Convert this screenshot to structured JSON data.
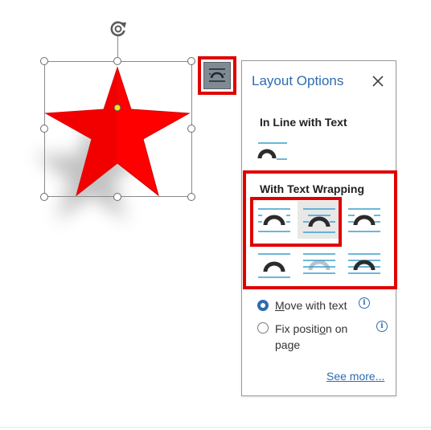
{
  "panel": {
    "title": "Layout Options",
    "inline_section": "In Line with Text",
    "wrapping_section": "With Text Wrapping",
    "options": {
      "move_with_text_pre": "",
      "move_with_text_ul": "M",
      "move_with_text_post": "ove with text",
      "fix_position_pre": "Fix positi",
      "fix_position_ul": "o",
      "fix_position_post": "n on",
      "fix_position_line2": "page"
    },
    "see_more": "See more..."
  },
  "colors": {
    "accent": "#2e6bb3",
    "highlight": "#e00000",
    "star": "#ff0000"
  },
  "icons": [
    "rotate-icon",
    "layout-options-icon",
    "close-icon",
    "info-icon"
  ]
}
